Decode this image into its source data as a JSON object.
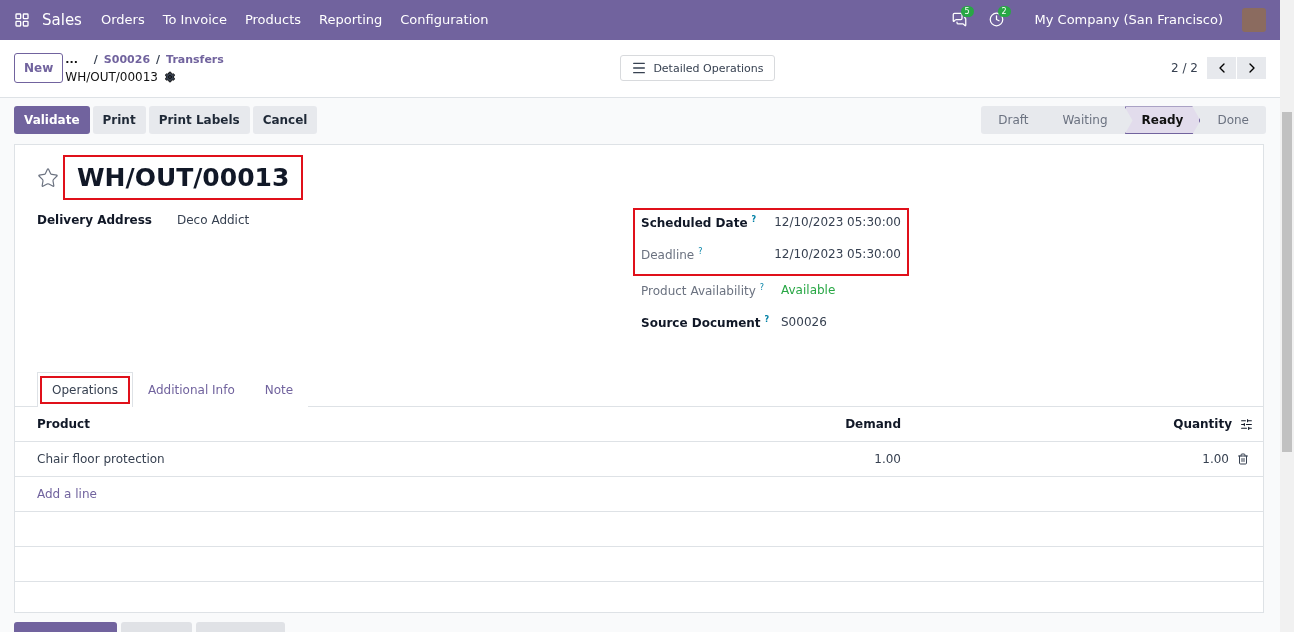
{
  "navbar": {
    "app": "Sales",
    "menus": [
      "Orders",
      "To Invoice",
      "Products",
      "Reporting",
      "Configuration"
    ],
    "messages_badge": "5",
    "activities_badge": "2",
    "company": "My Company (San Francisco)"
  },
  "control_panel": {
    "new_button": "New",
    "breadcrumbs": [
      "...",
      "S00026",
      "Transfers"
    ],
    "breadcrumb_separator": "/",
    "record": "WH/OUT/00013",
    "view_button": "Detailed Operations",
    "pager": "2 / 2"
  },
  "actions": [
    {
      "label": "Validate",
      "kind": "primary"
    },
    {
      "label": "Print",
      "kind": "secondary"
    },
    {
      "label": "Print Labels",
      "kind": "secondary"
    },
    {
      "label": "Cancel",
      "kind": "secondary"
    }
  ],
  "statusbar": [
    {
      "label": "Draft",
      "selected": false
    },
    {
      "label": "Waiting",
      "selected": false
    },
    {
      "label": "Ready",
      "selected": true
    },
    {
      "label": "Done",
      "selected": false
    }
  ],
  "form": {
    "title": "WH/OUT/00013",
    "title_highlighted": true,
    "starred": false,
    "left_fields": [
      {
        "label": "Delivery Address",
        "value": "Deco Addict",
        "kind": "bold"
      }
    ],
    "right_fields": [
      {
        "label": "Scheduled Date",
        "value": "12/10/2023 05:30:00",
        "kind": "bold",
        "help": true,
        "highlighted": true
      },
      {
        "label": "Deadline",
        "value": "12/10/2023 05:30:00",
        "kind": "muted",
        "help": true,
        "highlighted": true
      },
      {
        "label": "Product Availability",
        "value": "Available",
        "kind": "status",
        "help": true,
        "highlighted": false
      },
      {
        "label": "Source Document",
        "value": "S00026",
        "kind": "bold",
        "help": true,
        "highlighted": false
      }
    ],
    "help_mark": "?",
    "tabs": [
      {
        "label": "Operations",
        "selected": true,
        "highlighted": true
      },
      {
        "label": "Additional Info",
        "selected": false,
        "highlighted": false
      },
      {
        "label": "Note",
        "selected": false,
        "highlighted": false
      }
    ],
    "table": {
      "columns": [
        "Product",
        "Demand",
        "Quantity"
      ],
      "rows": [
        {
          "product": "Chair floor protection",
          "demand": "1.00",
          "quantity": "1.00"
        }
      ],
      "add_line": "Add a line"
    }
  }
}
